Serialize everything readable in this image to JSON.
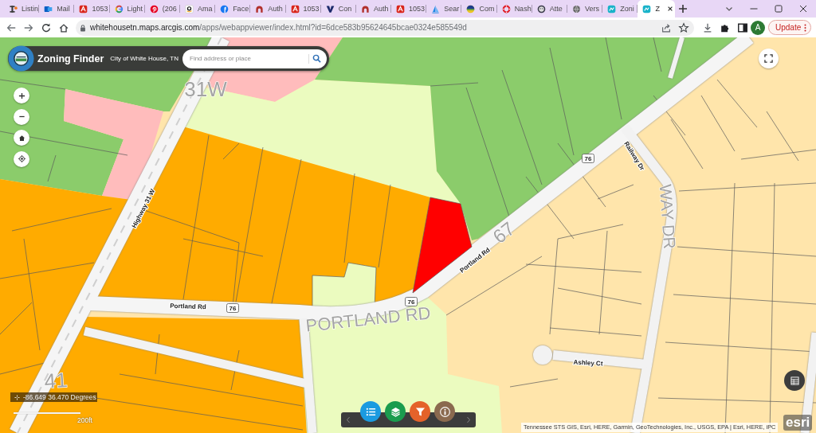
{
  "browser": {
    "tabs": [
      {
        "title": "Listin",
        "selected": false
      },
      {
        "title": "Mail",
        "selected": false
      },
      {
        "title": "1053",
        "selected": false
      },
      {
        "title": "Light",
        "selected": false
      },
      {
        "title": "(206",
        "selected": false
      },
      {
        "title": "Ama",
        "selected": false
      },
      {
        "title": "Face",
        "selected": false
      },
      {
        "title": "Auth",
        "selected": false
      },
      {
        "title": "1053",
        "selected": false
      },
      {
        "title": "Con",
        "selected": false
      },
      {
        "title": "Auth",
        "selected": false
      },
      {
        "title": "1053",
        "selected": false
      },
      {
        "title": "Sear",
        "selected": false
      },
      {
        "title": "Com",
        "selected": false
      },
      {
        "title": "Nash",
        "selected": false
      },
      {
        "title": "Atte",
        "selected": false
      },
      {
        "title": "Vers",
        "selected": false
      },
      {
        "title": "Zoni",
        "selected": false
      },
      {
        "title": "Z",
        "selected": true
      }
    ],
    "address_bar": {
      "host": "whitehousetn.maps.arcgis.com",
      "path": "/apps/webappviewer/index.html?id=6dce583b95624645bcae0324e585549d"
    },
    "profile": {
      "initial": "A"
    },
    "update_button": {
      "label": "Update"
    }
  },
  "app": {
    "title": "Zoning Finder",
    "subtitle": "City of White House, TN",
    "search": {
      "placeholder": "Find address or place"
    }
  },
  "map": {
    "labels": [
      {
        "kind": "highway",
        "text": "31W"
      },
      {
        "kind": "road",
        "text": "Highway 31 W"
      },
      {
        "kind": "highway",
        "text": "41"
      },
      {
        "kind": "road",
        "text": "Portland Rd"
      },
      {
        "kind": "shield",
        "text": "76"
      },
      {
        "kind": "highway",
        "text": "PORTLAND RD"
      },
      {
        "kind": "road",
        "text": "Portland Rd"
      },
      {
        "kind": "highway",
        "text": "67"
      },
      {
        "kind": "shield",
        "text": "76"
      },
      {
        "kind": "shield",
        "text": "76"
      },
      {
        "kind": "road",
        "text": "Railway Dr"
      },
      {
        "kind": "highway",
        "text": "WAY DR"
      },
      {
        "kind": "road",
        "text": "Ashley Ct"
      }
    ],
    "coordinates": "-86.649 36.470 Degrees",
    "scale_bar": {
      "label": "200ft"
    },
    "attribution": "Tennessee STS GIS, Esri, HERE, Garmin, GeoTechnologies, Inc., USGS, EPA | Esri, HERE, iPC",
    "logo": "esri"
  },
  "widgets": [
    {
      "kind": "legend",
      "color": "#1b9be0"
    },
    {
      "kind": "layers",
      "color": "#1a9c4e"
    },
    {
      "kind": "filter",
      "color": "#e4622a"
    },
    {
      "kind": "about",
      "color": "#8b6a4f"
    }
  ]
}
